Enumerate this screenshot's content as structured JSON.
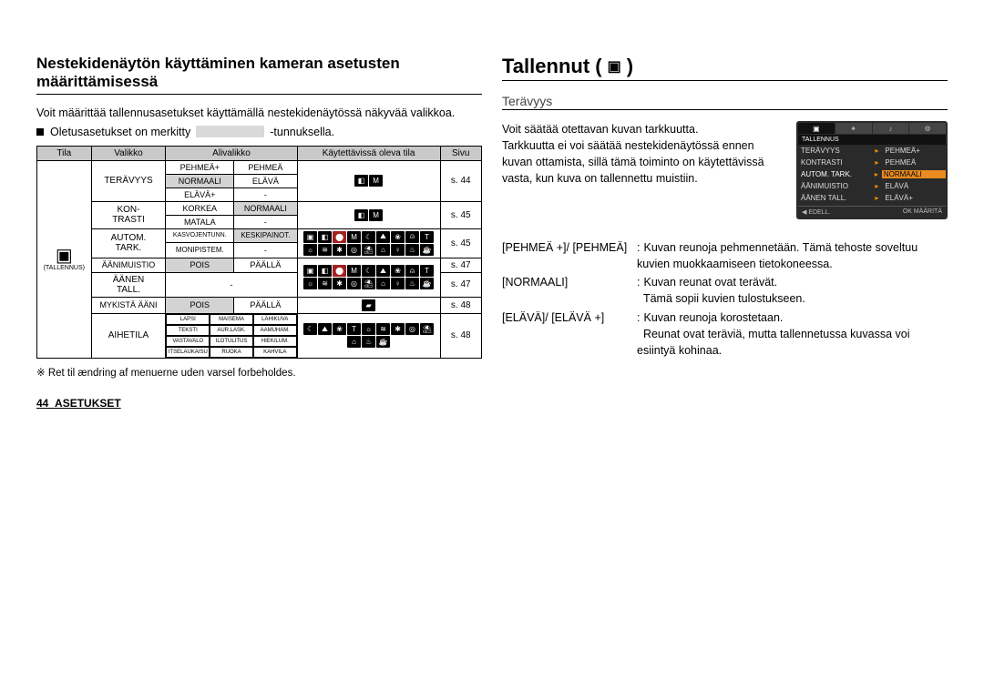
{
  "left": {
    "title": "Nestekidenäytön käyttäminen kameran asetusten määrittämisessä",
    "intro1": "Voit määrittää tallennusasetukset käyttämällä nestekidenäytössä näkyvää valikkoa.",
    "bullet_pre": "Oletusasetukset on merkitty",
    "bullet_post": "-tunnuksella.",
    "headers": {
      "mode": "Tila",
      "menu": "Valikko",
      "submenu": "Alivalikko",
      "available": "Käytettävissä oleva tila",
      "page": "Sivu"
    },
    "mode_label": "(TALLENNUS)",
    "rows": {
      "teravyys": {
        "label": "TERÄVYYS",
        "s1a": "PEHMEÄ+",
        "s1b": "PEHMEÄ",
        "s2a": "NORMAALI",
        "s2b": "ELÄVÄ",
        "s3a": "ELÄVÄ+",
        "s3b": "-",
        "page": "s. 44"
      },
      "kontrasti": {
        "label": "KON-\nTRASTI",
        "s1a": "KORKEA",
        "s1b": "NORMAALI",
        "s2a": "MATALA",
        "s2b": "-",
        "page": "s. 45"
      },
      "autom": {
        "label": "AUTOM.\nTARK.",
        "s1a": "KASVOJENTUNN.",
        "s1b": "KESKIPAINOT.",
        "s2a": "MONIPISTEM.",
        "s2b": "-",
        "page": "s. 45"
      },
      "aani": {
        "label": "ÄÄNIMUISTIO",
        "s1a": "POIS",
        "s1b": "PÄÄLLÄ",
        "page": "s. 47"
      },
      "aanen": {
        "label": "ÄÄNEN\nTALL.",
        "s1": "-",
        "page": "s. 47"
      },
      "mykista": {
        "label": "MYKISTÄ ÄÄNI",
        "s1a": "POIS",
        "s1b": "PÄÄLLÄ",
        "page": "s. 48"
      },
      "aihetila": {
        "label": "AIHETILA",
        "grid": [
          "LAPSI",
          "MAISEMA",
          "LÄHIKUVA",
          "TEKSTI",
          "AUR.LASK.",
          "AAMUHAM.",
          "VASTAVALO",
          "ILOTULITUS",
          "HIEK/LUM.",
          "ITSELAUKAISU",
          "RUOKA",
          "KAHVILA"
        ],
        "page": "s. 48"
      }
    },
    "note": "※ Ret til ændring af menuerne uden varsel forbeholdes.",
    "footer": "44_ASETUKSET"
  },
  "right": {
    "title": "Tallennut (",
    "title_end": ")",
    "subheading": "Terävyys",
    "body": "Voit säätää otettavan kuvan tarkkuutta.\nTarkkuutta ei voi säätää nestekidenäytössä ennen kuvan ottamista, sillä tämä toiminto on käytettävissä vasta, kun kuva on tallennettu muistiin.",
    "preview": {
      "header": "TALLENNUS",
      "rows": [
        {
          "l": "TERÄVYYS",
          "r": "PEHMEÄ+"
        },
        {
          "l": "KONTRASTI",
          "r": "PEHMEÄ"
        },
        {
          "l": "AUTOM. TARK.",
          "r": "NORMAALI",
          "sel": true
        },
        {
          "l": "ÄÄNIMUISTIO",
          "r": "ELÄVÄ"
        },
        {
          "l": "ÄÄNEN TALL.",
          "r": "ELÄVÄ+"
        }
      ],
      "ftr_left": "◀ EDELL.",
      "ftr_right": "OK  MÄÄRITÄ"
    },
    "defs": [
      {
        "label": "[PEHMEÄ +]/ [PEHMEÄ]",
        "colon": ":",
        "text": "Kuvan reunoja pehmennetään. Tämä tehoste soveltuu kuvien muokkaamiseen tietokoneessa."
      },
      {
        "label": "[NORMAALI]",
        "colon": ":",
        "text": "Kuvan reunat ovat terävät.\nTämä sopii kuvien tulostukseen."
      },
      {
        "label": "[ELÄVÄ]/ [ELÄVÄ +]",
        "colon": ":",
        "text": "Kuvan reunoja korostetaan.\nReunat ovat teräviä, mutta tallennetussa kuvassa voi esiintyä kohinaa."
      }
    ]
  }
}
